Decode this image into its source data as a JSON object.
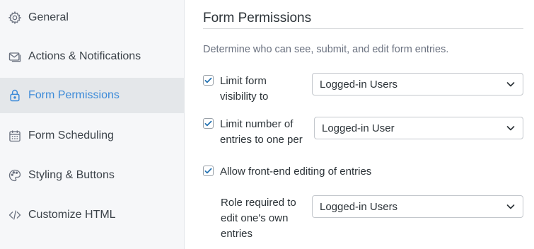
{
  "sidebar": {
    "items": [
      {
        "label": "General",
        "icon": "gear-icon"
      },
      {
        "label": "Actions & Notifications",
        "icon": "envelope-icon"
      },
      {
        "label": "Form Permissions",
        "icon": "lock-icon",
        "active": true
      },
      {
        "label": "Form Scheduling",
        "icon": "calendar-icon"
      },
      {
        "label": "Styling & Buttons",
        "icon": "palette-icon"
      },
      {
        "label": "Customize HTML",
        "icon": "code-icon"
      }
    ]
  },
  "main": {
    "title": "Form Permissions",
    "description": "Determine who can see, submit, and edit form entries.",
    "options": [
      {
        "label": "Limit form visibility to",
        "checked": true,
        "select_value": "Logged-in Users"
      },
      {
        "label": "Limit number of entries to one per",
        "checked": true,
        "select_value": "Logged-in User"
      },
      {
        "label": "Allow front-end editing of entries",
        "checked": true
      }
    ],
    "role_required": {
      "label": "Role required to edit one's own entries",
      "select_value": "Logged-in Users"
    }
  },
  "colors": {
    "accent": "#3b8ad8",
    "checkbox": "#2271b1",
    "sidebar_bg": "#f6f7f9",
    "active_bg": "#e4e7ea"
  }
}
